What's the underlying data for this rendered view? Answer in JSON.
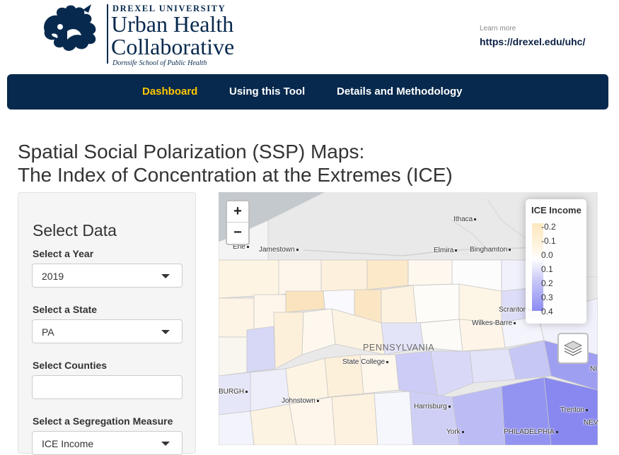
{
  "header": {
    "logo": {
      "university": "DREXEL UNIVERSITY",
      "line1": "Urban Health",
      "line2": "Collaborative",
      "school": "Dornsife School of Public Health"
    },
    "learn_more_label": "Learn more",
    "learn_more_link": "https://drexel.edu/uhc/"
  },
  "nav": {
    "items": [
      {
        "label": "Dashboard",
        "active": true
      },
      {
        "label": "Using this Tool",
        "active": false
      },
      {
        "label": "Details and Methodology",
        "active": false
      }
    ],
    "active_color": "#ffc600",
    "bar_color": "#07294d"
  },
  "page": {
    "title_line1": "Spatial Social Polarization (SSP) Maps:",
    "title_line2": "The Index of Concentration at the Extremes (ICE)"
  },
  "sidebar": {
    "title": "Select Data",
    "year_label": "Select a Year",
    "year_value": "2019",
    "state_label": "Select a State",
    "state_value": "PA",
    "counties_label": "Select Counties",
    "counties_value": "",
    "measure_label": "Select a Segregation Measure",
    "measure_value": "ICE Income"
  },
  "map": {
    "zoom_in": "+",
    "zoom_out": "−",
    "state_name": "PENNSYLVANIA",
    "cities": [
      "Ithaca",
      "Erie",
      "Jamestown",
      "Elmira",
      "Binghamton",
      "Scranton",
      "Wilkes-Barre",
      "State College",
      "BURGH",
      "Johnstown",
      "Harrisburg",
      "Trenton",
      "York",
      "PHILADELPHIA",
      "NI",
      "NEV"
    ],
    "legend": {
      "title": "ICE Income",
      "ticks": [
        "-0.2",
        "-0.1",
        "0.0",
        "0.1",
        "0.2",
        "0.3",
        "0.4"
      ],
      "color_low": "#fde7bf",
      "color_mid": "#ffffff",
      "color_high": "#8b8bf4"
    },
    "icons": [
      "zoom-in-icon",
      "zoom-out-icon",
      "layers-icon"
    ]
  }
}
